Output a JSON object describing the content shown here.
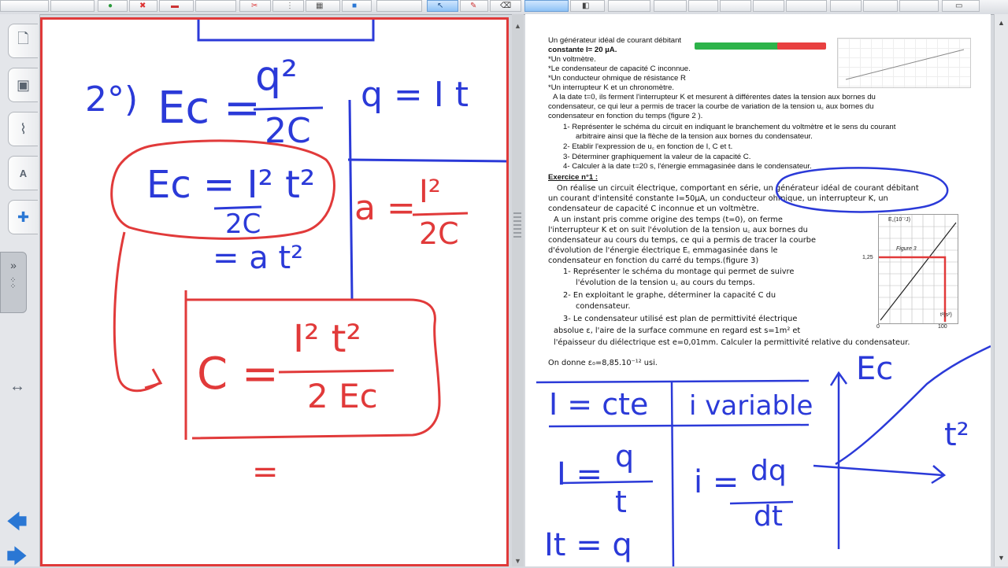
{
  "colors": {
    "pen_blue": "#2b3ad8",
    "pen_red": "#e13a3a",
    "accent": "#2a77d4"
  },
  "toolbar": {
    "icons": [
      "color-icon",
      "delete-icon",
      "highlight-icon",
      "scissors-icon",
      "text-icon",
      "table-icon",
      "insert-icon",
      "pointer-icon",
      "pen-icon",
      "eraser-icon",
      "line-icon",
      "shape-icon",
      "screen-icon"
    ]
  },
  "sidebar": {
    "tabs": [
      "page-sorter-icon",
      "gallery-icon",
      "attachments-icon",
      "properties-icon",
      "addons-icon"
    ]
  },
  "board": {
    "item": "2°)",
    "ec_eq": "Ec =",
    "q2": "q²",
    "two_c": "2C",
    "q_eq": "q = I t",
    "ec2_eq": "Ec = I² t²",
    "ec2_den": "2C",
    "a_eq": "a =",
    "a_num": "I²",
    "a_den": "2C",
    "eq_at2": "= a t²",
    "c_eq": "C =",
    "c_num": "I² t²",
    "c_den": "2 Ec",
    "eq_sign": "="
  },
  "doc": {
    "line1": "Un générateur idéal de courant débitant",
    "line2": "constante I= 20 µA.",
    "line3": "*Un voltmètre.",
    "line4": "*Le condensateur de capacité C inconnue.",
    "line5": "*Un conducteur ohmique de résistance R",
    "line6": "*Un interrupteur K et un chronomètre.",
    "line7": "A la date t=0, ils ferment l'interrupteur K et mesurent à différentes dates la tension aux bornes du",
    "line8": "condensateur, ce qui leur a permis de tracer la courbe de variation de la tension u꜀ aux bornes du",
    "line9": "condensateur en fonction du temps (figure 2 ).",
    "q1": "1-   Représenter le schéma du circuit en indiquant le branchement du voltmètre et le sens du courant",
    "q1b": "arbitraire ainsi que la flèche de la tension aux bornes du condensateur.",
    "q2": "2-   Etablir l'expression de u꜀ en fonction de I, C et t.",
    "q3": "3-   Déterminer graphiquement la valeur de la capacité C.",
    "q4": "4-   Calculer à la date t=20 s, l'énergie emmagasinée dans le condensateur.",
    "ex_title": "Exercice n°1 :",
    "p1": "On réalise un circuit électrique, comportant en série, un générateur idéal de courant débitant",
    "p2": "un courant d'intensité constante I=50µA, un conducteur ohmique, un interrupteur K, un",
    "p3": "condensateur de capacité C inconnue et un voltmètre.",
    "p4": "A un instant pris comme origine des temps (t=0), on ferme",
    "p5": "l'interrupteur K et on suit l'évolution de la tension u꜀ aux bornes du",
    "p6": "condensateur au cours du temps, ce qui a permis de tracer la courbe",
    "p7": "d'évolution de l'énergie électrique E꜀ emmagasinée dans le",
    "p8": "condensateur en fonction du carré du temps.(figure 3)",
    "e1": "1-   Représenter le schéma du montage qui permet de suivre",
    "e1b": "l'évolution de la tension u꜀ au cours du temps.",
    "e2": "2-  En exploitant le graphe, déterminer la capacité C du",
    "e2b": "condensateur.",
    "e3": "3-  Le condensateur utilisé est plan de permittivité électrique",
    "e3b": "absolue ε, l'aire de la surface commune en regard est s=1m² et",
    "e3c": "l'épaisseur du diélectrique est e=0,01mm. Calculer la permittivité relative du condensateur.",
    "given": "On donne ε₀=8,85.10⁻¹² usi.",
    "fig_label": "Figure 3",
    "fig_y": "1,25",
    "fig_x0": "0",
    "fig_x1": "100",
    "fig_ec": "E꜀(10⁻⁷J)",
    "fig_t": "t²(s²)"
  },
  "notes": {
    "i_cte": "I = cte",
    "i_var": "i variable",
    "i_frac_left": "I =",
    "i_frac_num": "q",
    "i_frac_den": "t",
    "i_deriv_left": "i =",
    "i_deriv_num": "dq",
    "i_deriv_den": "dt",
    "it_q": "It = q",
    "ec_axis": "Ec",
    "t2_axis": "t²"
  }
}
